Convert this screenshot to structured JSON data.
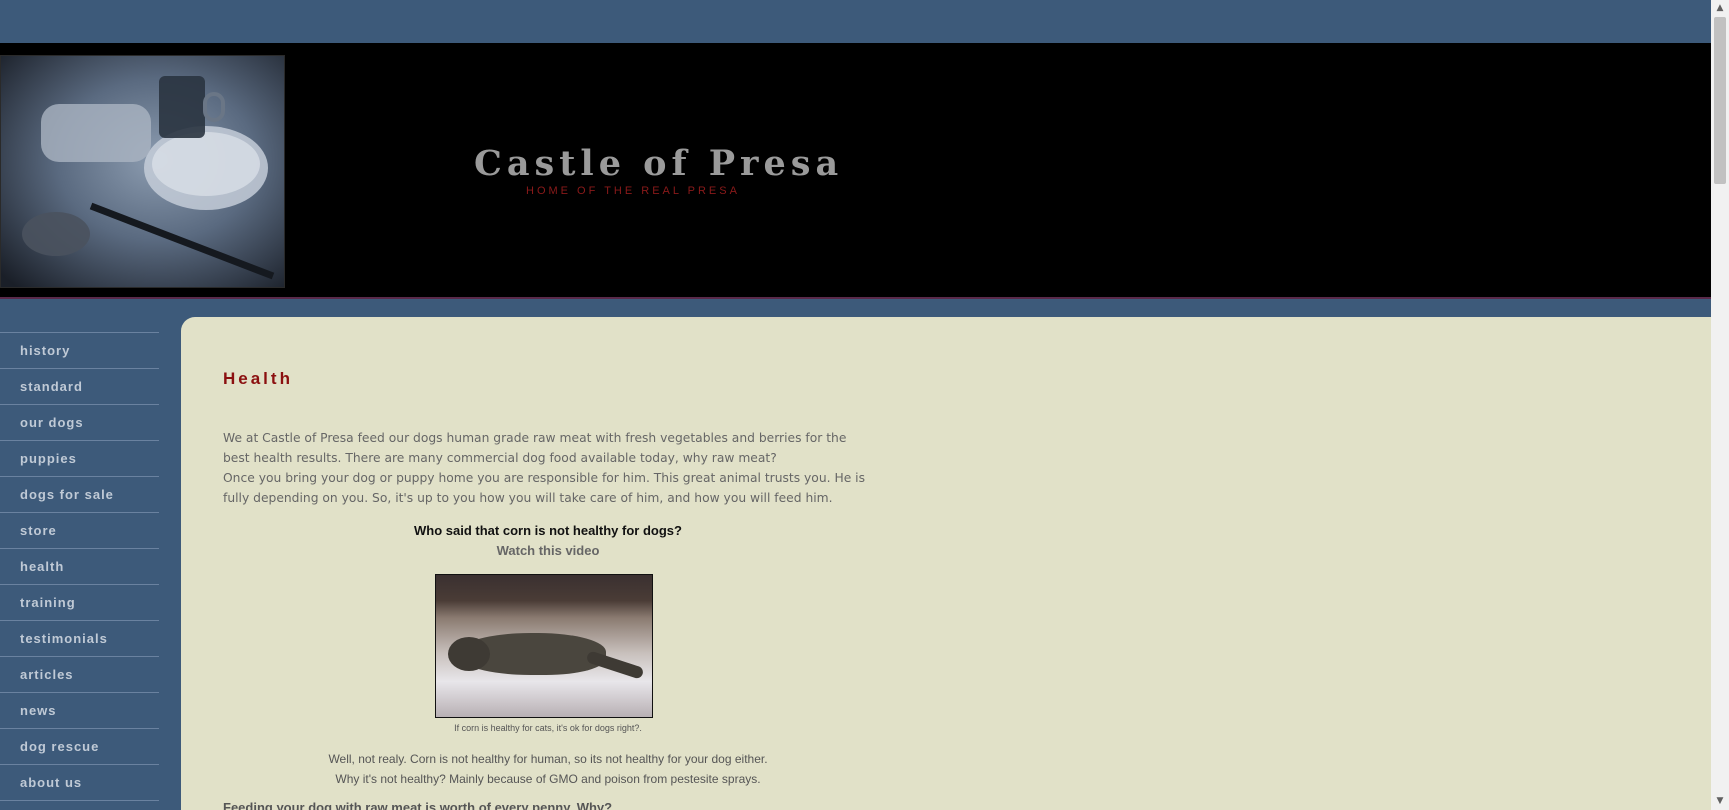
{
  "header": {
    "title": "Castle of Presa",
    "subtitle": "HOME OF THE REAL PRESA"
  },
  "sidebar": {
    "items": [
      {
        "label": "history"
      },
      {
        "label": "standard"
      },
      {
        "label": "our dogs"
      },
      {
        "label": "puppies"
      },
      {
        "label": "dogs for sale"
      },
      {
        "label": "store"
      },
      {
        "label": "health"
      },
      {
        "label": "training"
      },
      {
        "label": "testimonials"
      },
      {
        "label": "articles"
      },
      {
        "label": "news"
      },
      {
        "label": "dog rescue"
      },
      {
        "label": "about us"
      }
    ]
  },
  "main": {
    "heading": "Health",
    "intro_p1": "We at Castle of Presa feed our dogs human grade raw meat with fresh vegetables and berries for the best health results. There are many commercial dog food available today, why raw meat?",
    "intro_p2": "Once you bring your dog or puppy home you are responsible for him. This great animal trusts you. He is fully depending on you. So, it's up to you how you will take care of him, and how you will feed him.",
    "video_question": "Who said that corn is not healthy for dogs?",
    "video_link": "Watch this video",
    "video_caption": "If corn is healthy for cats, it's ok for dogs right?.",
    "para3_line1": "Well, not realy. Corn is not healthy for human, so its not healthy for your dog either.",
    "para3_line2": "Why it's not healthy? Mainly because of GMO and poison from pestesite sprays.",
    "para4": "Feeding your dog with raw meat is worth of every penny. Why?"
  },
  "colors": {
    "page_background": "#3d5a7a",
    "header_background": "#000000",
    "content_background": "#e1e1c8",
    "heading": "#8b1010",
    "title": "#9a9a9a"
  }
}
